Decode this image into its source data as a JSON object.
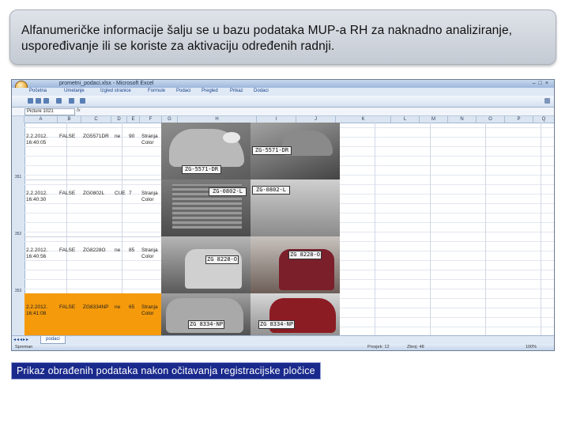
{
  "slide": {
    "heading": "Alfanumeričke informacije šalju se u bazu podataka MUP-a RH za naknadno analiziranje, uspoređivanje ili se koriste za aktivaciju određenih radnji.",
    "caption": "Prikaz obrađenih podataka nakon očitavanja registracijske pločice"
  },
  "excel": {
    "title": "prometni_podaci.xlsx - Microsoft Excel",
    "ribbon_tabs": [
      "Početna",
      "Umetanje",
      "Izgled stranice",
      "Formule",
      "Podaci",
      "Pregled",
      "Prikaz",
      "Dodaci"
    ],
    "name_box": "Picture 1021",
    "columns": [
      "A",
      "B",
      "C",
      "D",
      "E",
      "F",
      "G",
      "H",
      "I",
      "J",
      "K",
      "L",
      "M",
      "N",
      "O",
      "P",
      "Q"
    ],
    "row_numbers": [
      "351",
      "352",
      "353"
    ],
    "rows": [
      {
        "datetime": "2.2.2012. 16:40:05",
        "flag": "FALSE",
        "plate": "ZG5571DR",
        "speed": "ne",
        "count": "90",
        "status": "Stranja Color"
      },
      {
        "datetime": "2.2.2012. 16:40:30",
        "flag": "FALSE",
        "plate": "ZG0802L",
        "speed": "CUE",
        "count": "7",
        "status": "Stranja Color"
      },
      {
        "datetime": "2.2.2012. 16:40:56",
        "flag": "FALSE",
        "plate": "ZG8228O",
        "speed": "ne",
        "count": "85",
        "status": "Stranja Color"
      },
      {
        "datetime": "2.2.2012. 16:41:08",
        "flag": "FALSE",
        "plate": "ZG8334NP",
        "speed": "ne",
        "count": "65",
        "status": "Stranja Color"
      }
    ],
    "photo_plates": [
      "ZG-5571-DR",
      "ZG-0802-L",
      "ZG 8228-O",
      "ZG 8334-NP"
    ],
    "photo_plates_right": [
      "ZG-5571-DR",
      "ZG-0802-L",
      "ZG 8228-O",
      "ZG 8334-NP"
    ],
    "sheet_tab": "podaci",
    "status_items": [
      "Spreman",
      "Prosjek: 12",
      "Zbroj: 48",
      "100%"
    ]
  },
  "colors": {
    "highlight_row": "#f59a0b",
    "caption_bg": "#1a2a8c"
  }
}
